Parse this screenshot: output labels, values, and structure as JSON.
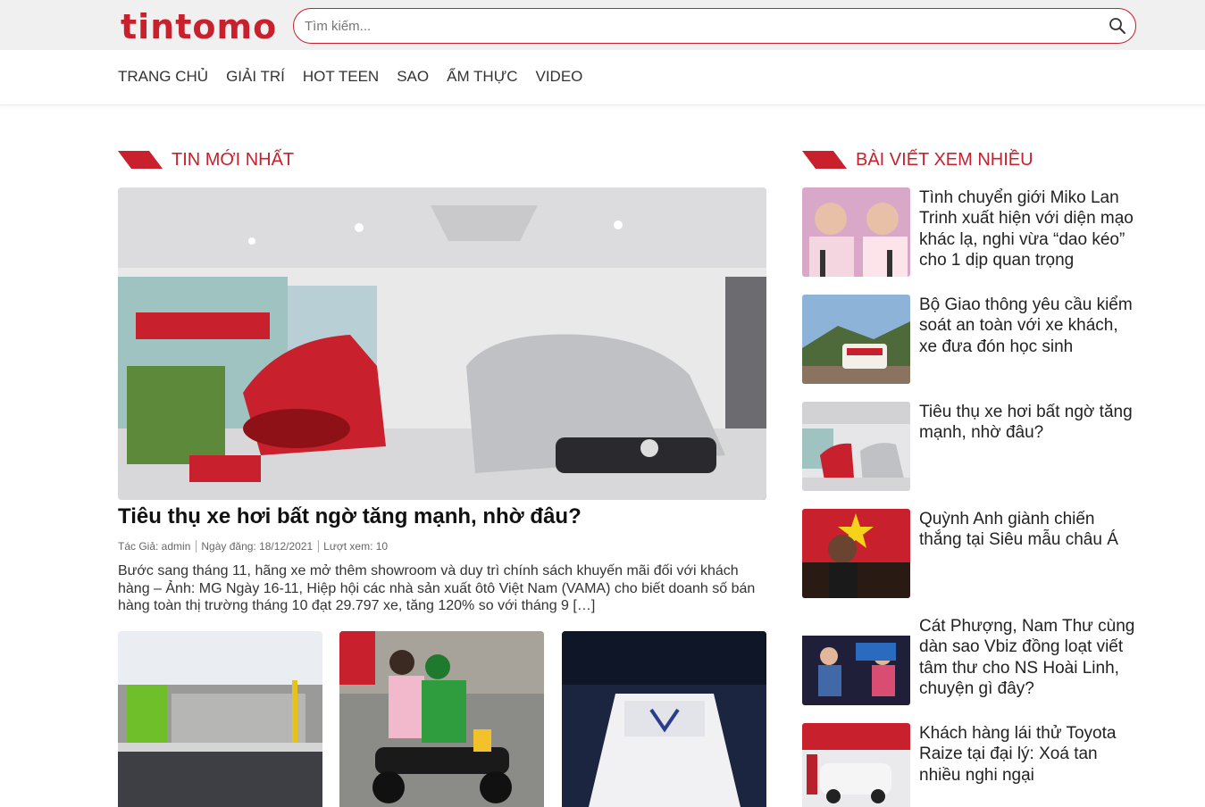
{
  "header": {
    "logo": "tintomo",
    "search_placeholder": "Tìm kiếm..."
  },
  "nav": [
    "TRANG CHỦ",
    "GIẢI TRÍ",
    "HOT TEEN",
    "SAO",
    "ẨM THỰC",
    "VIDEO"
  ],
  "latest": {
    "heading": "TIN MỚI NHẤT",
    "featured": {
      "title": "Tiêu thụ xe hơi bất ngờ tăng mạnh, nhờ đâu?",
      "author": "Tác Giả: admin",
      "date": "Ngày đăng: 18/12/2021",
      "views": "Lượt xem: 10",
      "excerpt": "Bước sang tháng 11, hãng xe mở thêm showroom và duy trì chính sách khuyến mãi đối với khách hàng – Ảnh: MG Ngày 16-11, Hiệp hội các nhà sản xuất ôtô Việt Nam (VAMA) cho biết doanh số bán hàng toàn thị trường tháng 10 đạt 29.797 xe, tăng 120% so với tháng 9 […]"
    }
  },
  "popular": {
    "heading": "BÀI VIẾT XEM NHIỀU",
    "items": [
      {
        "title": "Tình chuyển giới Miko Lan Trinh xuất hiện với diện mạo khác lạ, nghi vừa “dao kéo” cho 1 dịp quan trọng"
      },
      {
        "title": "Bộ Giao thông yêu cầu kiểm soát an toàn với xe khách, xe đưa đón học sinh"
      },
      {
        "title": "Tiêu thụ xe hơi bất ngờ tăng mạnh, nhờ đâu?"
      },
      {
        "title": "Quỳnh Anh giành chiến thắng tại Siêu mẫu châu Á"
      },
      {
        "title": "Cát Phượng, Nam Thư cùng dàn sao Vbiz đồng loạt viết tâm thư cho NS Hoài Linh, chuyện gì đây?"
      },
      {
        "title": "Khách hàng lái thử Toyota Raize tại đại lý: Xoá tan nhiều nghi ngại"
      }
    ]
  },
  "colors": {
    "accent": "#c8202c"
  }
}
